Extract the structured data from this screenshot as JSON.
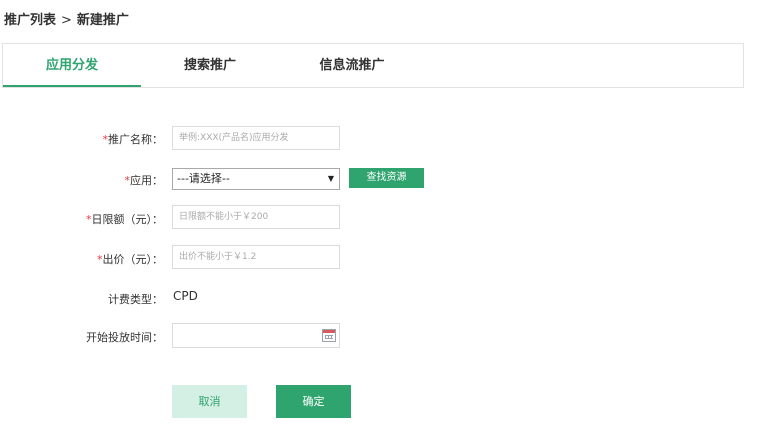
{
  "breadcrumb": {
    "parent": "推广列表",
    "separator": ">",
    "current": "新建推广"
  },
  "tabs": [
    {
      "label": "应用分发",
      "active": true
    },
    {
      "label": "搜索推广",
      "active": false
    },
    {
      "label": "信息流推广",
      "active": false
    }
  ],
  "form": {
    "name": {
      "required_mark": "*",
      "label": "推广名称：",
      "placeholder": "举例:XXX(产品名)应用分发"
    },
    "app": {
      "required_mark": "*",
      "label": "应用：",
      "selected": "---请选择--",
      "find_button": "查找资源"
    },
    "daily_limit": {
      "required_mark": "*",
      "label": "日限额（元）：",
      "placeholder": "日限额不能小于￥200"
    },
    "bid": {
      "required_mark": "*",
      "label": "出价（元）：",
      "placeholder": "出价不能小于￥1.2"
    },
    "billing": {
      "label": "计费类型：",
      "value": "CPD"
    },
    "start_time": {
      "label": "开始投放时间：",
      "value": ""
    }
  },
  "actions": {
    "cancel": "取消",
    "confirm": "确定"
  },
  "colors": {
    "accent": "#2fa46f",
    "required": "#e4393c",
    "cancel_bg": "#d4efe3"
  },
  "icons": {
    "calendar": "calendar-icon",
    "select_arrow": "chevron-down-icon"
  }
}
